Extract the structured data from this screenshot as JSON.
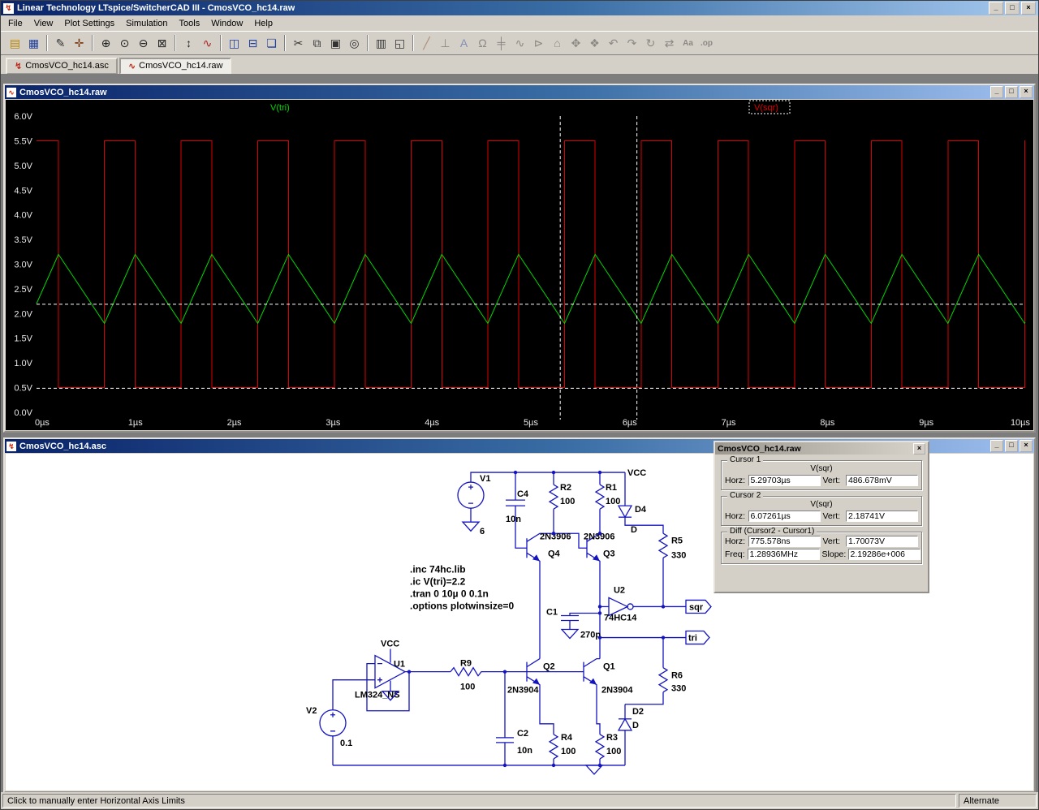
{
  "titlebar": {
    "title": "Linear Technology LTspice/SwitcherCAD III - CmosVCO_hc14.raw"
  },
  "window_glyphs": {
    "app": "↯",
    "min": "_",
    "max": "□",
    "close": "×",
    "wave": "∿",
    "schem": "↯"
  },
  "menu": {
    "items": [
      "File",
      "View",
      "Plot Settings",
      "Simulation",
      "Tools",
      "Window",
      "Help"
    ]
  },
  "toolbar": {
    "icons": [
      {
        "name": "open",
        "glyph": "▤",
        "color": "#b8860b"
      },
      {
        "name": "save",
        "glyph": "▦",
        "color": "#1f3f9f"
      },
      {
        "sep": true
      },
      {
        "name": "new-schematic",
        "glyph": "✎",
        "color": "#333333"
      },
      {
        "name": "control-panel",
        "glyph": "✛",
        "color": "#7a3b10"
      },
      {
        "sep": true
      },
      {
        "name": "zoom-in",
        "glyph": "⊕",
        "color": "#222222"
      },
      {
        "name": "zoom-back",
        "glyph": "⊙",
        "color": "#222222"
      },
      {
        "name": "zoom-out",
        "glyph": "⊖",
        "color": "#222222"
      },
      {
        "name": "zoom-full-extents",
        "glyph": "⊠",
        "color": "#222222"
      },
      {
        "sep": true
      },
      {
        "name": "autorange",
        "glyph": "↕",
        "color": "#222222"
      },
      {
        "name": "plot-settings",
        "glyph": "∿",
        "color": "#aa2222"
      },
      {
        "sep": true
      },
      {
        "name": "tile-vertical",
        "glyph": "◫",
        "color": "#1f3f9f"
      },
      {
        "name": "tile-horizontal",
        "glyph": "⊟",
        "color": "#1f3f9f"
      },
      {
        "name": "cascade",
        "glyph": "❏",
        "color": "#1f3f9f"
      },
      {
        "sep": true
      },
      {
        "name": "cut",
        "glyph": "✂",
        "color": "#333333"
      },
      {
        "name": "copy",
        "glyph": "⧉",
        "color": "#333333"
      },
      {
        "name": "paste",
        "glyph": "▣",
        "color": "#333333"
      },
      {
        "name": "find",
        "glyph": "◎",
        "color": "#333333"
      },
      {
        "sep": true
      },
      {
        "name": "print",
        "glyph": "▥",
        "color": "#333333"
      },
      {
        "name": "print-preview",
        "glyph": "◱",
        "color": "#333333"
      },
      {
        "sep": true
      },
      {
        "name": "wire",
        "glyph": "╱",
        "color": "#7a3b10",
        "disabled": true
      },
      {
        "name": "ground",
        "glyph": "⊥",
        "color": "#333333",
        "disabled": true
      },
      {
        "name": "label-net",
        "glyph": "A",
        "color": "#1f3f9f",
        "disabled": true
      },
      {
        "name": "resistor",
        "glyph": "Ω",
        "color": "#333333",
        "disabled": true
      },
      {
        "name": "capacitor",
        "glyph": "╪",
        "color": "#333333",
        "disabled": true
      },
      {
        "name": "inductor",
        "glyph": "∿",
        "color": "#333333",
        "disabled": true
      },
      {
        "name": "diode",
        "glyph": "⊳",
        "color": "#333333",
        "disabled": true
      },
      {
        "name": "component",
        "glyph": "⌂",
        "color": "#333333",
        "disabled": true
      },
      {
        "name": "move",
        "glyph": "✥",
        "color": "#333333",
        "disabled": true
      },
      {
        "name": "drag",
        "glyph": "❖",
        "color": "#333333",
        "disabled": true
      },
      {
        "name": "undo",
        "glyph": "↶",
        "color": "#333333",
        "disabled": true
      },
      {
        "name": "redo",
        "glyph": "↷",
        "color": "#333333",
        "disabled": true
      },
      {
        "name": "rotate",
        "glyph": "↻",
        "color": "#333333",
        "disabled": true
      },
      {
        "name": "mirror",
        "glyph": "⇄",
        "color": "#333333",
        "disabled": true
      },
      {
        "name": "text",
        "glyph": "Aa",
        "color": "#333333",
        "disabled": true
      },
      {
        "name": "spice-directive",
        "glyph": ".op",
        "color": "#333333",
        "disabled": true
      }
    ]
  },
  "tabs": [
    {
      "label": "CmosVCO_hc14.asc",
      "icon": "↯"
    },
    {
      "label": "CmosVCO_hc14.raw",
      "icon": "∿",
      "active": true
    }
  ],
  "wave": {
    "title": "CmosVCO_hc14.raw",
    "chart_data": {
      "type": "line",
      "x_ticks": [
        "0µs",
        "1µs",
        "2µs",
        "3µs",
        "4µs",
        "5µs",
        "6µs",
        "7µs",
        "8µs",
        "9µs",
        "10µs"
      ],
      "y_ticks": [
        "6.0V",
        "5.5V",
        "5.0V",
        "4.5V",
        "4.0V",
        "3.5V",
        "3.0V",
        "2.5V",
        "2.0V",
        "1.5V",
        "1.0V",
        "0.5V",
        "0.0V"
      ],
      "ylim": [
        0,
        6
      ],
      "xlim_us": [
        0,
        10
      ],
      "grid": false,
      "legend_position": "top",
      "series": [
        {
          "name": "V(tri)",
          "color": "#00d800",
          "shape": "triangle",
          "min_v": 1.8,
          "max_v": 3.2,
          "start_v": 2.2,
          "period_us": 0.775578,
          "rise_frac": 0.4
        },
        {
          "name": "V(sqr)",
          "color": "#dc0000",
          "shape": "square",
          "low_v": 0.5,
          "high_v": 5.5,
          "period_us": 0.775578
        }
      ],
      "cursors": {
        "c1_us": 5.29703,
        "c2_us": 6.07261,
        "h1_v": 0.486678,
        "h2_v": 2.18741
      }
    }
  },
  "schematic": {
    "title": "CmosVCO_hc14.asc",
    "directives": [
      ".inc 74hc.lib",
      ".ic V(tri)=2.2",
      ".tran 0 10µ 0 0.1n",
      ".options plotwinsize=0"
    ],
    "labels": {
      "v1": "V1",
      "v1_value": "6",
      "vcc_top": "VCC",
      "vcc_opamp": "VCC",
      "c4": "C4",
      "c4_value": "10n",
      "r2": "R2",
      "r2_value": "100",
      "r1": "R1",
      "r1_value": "100",
      "d4": "D4",
      "d4_value": "D",
      "r5": "R5",
      "r5_value": "330",
      "q4": "Q4",
      "q4_value": "2N3906",
      "q3": "Q3",
      "q3_value": "2N3906",
      "u2": "U2",
      "u2_value": "74HC14",
      "flag_sqr": "sqr",
      "flag_tri": "tri",
      "c1": "C1",
      "c1_value": "270p",
      "r6": "R6",
      "r6_value": "330",
      "q2": "Q2",
      "q2_value": "2N3904",
      "q1": "Q1",
      "q1_value": "2N3904",
      "d2": "D2",
      "d2_value": "D",
      "r9": "R9",
      "r9_value": "100",
      "u1": "U1",
      "u1_value": "LM324_NS",
      "v2": "V2",
      "v2_value": "0.1",
      "c2": "C2",
      "c2_value": "10n",
      "r4": "R4",
      "r4_value": "100",
      "r3": "R3",
      "r3_value": "100"
    }
  },
  "cursor_panel": {
    "title": "CmosVCO_hc14.raw",
    "labels": {
      "horz": "Horz:",
      "vert": "Vert:",
      "freq": "Freq:",
      "slope": "Slope:"
    },
    "cursor1": {
      "label": "Cursor 1",
      "signal": "V(sqr)",
      "horz": "5.29703µs",
      "vert": "486.678mV"
    },
    "cursor2": {
      "label": "Cursor 2",
      "signal": "V(sqr)",
      "horz": "6.07261µs",
      "vert": "2.18741V"
    },
    "diff": {
      "label": "Diff (Cursor2 - Cursor1)",
      "horz": "775.578ns",
      "vert": "1.70073V",
      "freq": "1.28936MHz",
      "slope": "2.19286e+006"
    }
  },
  "statusbar": {
    "left": "Click to manually enter Horizontal Axis Limits",
    "right": "Alternate"
  }
}
